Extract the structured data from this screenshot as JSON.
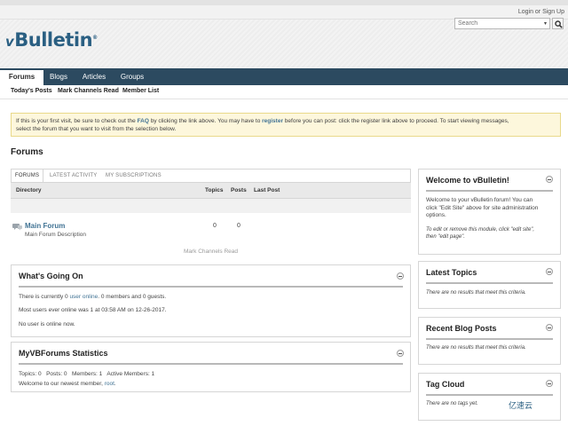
{
  "top": {
    "login": "Login or Sign Up"
  },
  "header": {
    "logo_prefix": "v",
    "logo_text": "Bulletin",
    "logo_mark": "®"
  },
  "search": {
    "placeholder": "Search",
    "caret": "▾"
  },
  "nav": {
    "tabs": [
      "Forums",
      "Blogs",
      "Articles",
      "Groups"
    ]
  },
  "subnav": {
    "items": [
      "Today's Posts",
      "Mark Channels Read",
      "Member List"
    ]
  },
  "notice": {
    "part1": "If this is your first visit, be sure to check out the ",
    "faq": "FAQ",
    "part2": " by clicking the link above. You may have to ",
    "register": "register",
    "part3": " before you can post: click the register link above to proceed. To start viewing messages,",
    "line2": "select the forum that you want to visit from the selection below."
  },
  "page": {
    "title": "Forums"
  },
  "forum_panel": {
    "tabs": [
      "FORUMS",
      "LATEST ACTIVITY",
      "MY SUBSCRIPTIONS"
    ],
    "columns": [
      "Directory",
      "Topics",
      "Posts",
      "Last Post"
    ],
    "forum": {
      "name": "Main Forum",
      "description": "Main Forum Description",
      "topics": "0",
      "posts": "0"
    },
    "mark_read": "Mark Channels Read"
  },
  "going_on": {
    "title": "What's Going On",
    "line1_a": "There is currently 0 ",
    "line1_link": "user online",
    "line1_b": ". 0 members and 0 guests.",
    "line2": "Most users ever online was 1 at 03:58 AM on 12-26-2017.",
    "line3": "No user is online now."
  },
  "stats": {
    "title": "MyVBForums Statistics",
    "line1": "Topics: 0   Posts: 0   Members: 1   Active Members: 1",
    "line2_a": "Welcome to our newest member, ",
    "line2_link": "root",
    "line2_b": "."
  },
  "welcome": {
    "title": "Welcome to vBulletin!",
    "text1": "Welcome to your vBulletin forum! You can",
    "text2": "click \"Edit Site\" above for site administration",
    "text3": "options.",
    "note1": "To edit or remove this module, click \"edit site\",",
    "note2": "then \"edit page\"."
  },
  "latest_topics": {
    "title": "Latest Topics",
    "empty": "There are no results that meet this criteria."
  },
  "blog_posts": {
    "title": "Recent Blog Posts",
    "empty": "There are no results that meet this criteria."
  },
  "tag_cloud": {
    "title": "Tag Cloud",
    "empty": "There are no tags yet."
  },
  "watermark": {
    "text": "亿速云"
  }
}
